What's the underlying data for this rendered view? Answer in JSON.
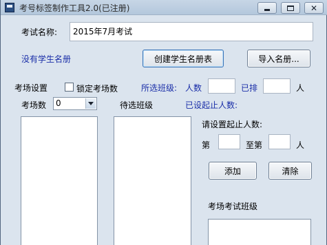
{
  "window": {
    "title": "考号标签制作工具2.0(已注册)",
    "controls": {
      "minimize": "▭",
      "maximize": "▢",
      "close": "✕"
    }
  },
  "exam_name": {
    "label": "考试名称:",
    "value": "2015年7月考试"
  },
  "status": {
    "no_students": "没有学生名册"
  },
  "buttons": {
    "create_roster": "创建学生名册表",
    "import_roster": "导入名册...",
    "add": "添加",
    "clear": "清除"
  },
  "room_settings": {
    "label": "考场设置",
    "lock_label": "锁定考场数",
    "lock_checked": false,
    "room_count_label": "考场数",
    "room_count_value": "0"
  },
  "selected_classes": {
    "label": "所选班级:",
    "people_label": "人数",
    "people_value": "",
    "arranged_label": "已排",
    "arranged_value": "",
    "unit": "人"
  },
  "pending_classes": {
    "label": "待选班级"
  },
  "range": {
    "set_label": "已设起止人数:",
    "prompt": "请设置起止人数:",
    "from_label": "第",
    "from_value": "",
    "to_label": "至第",
    "to_value": "",
    "unit": "人"
  },
  "exam_room_classes": {
    "label": "考场考试班级"
  },
  "colors": {
    "blue_label": "#1a2ea8",
    "window_bg": "#dbe4ee"
  }
}
